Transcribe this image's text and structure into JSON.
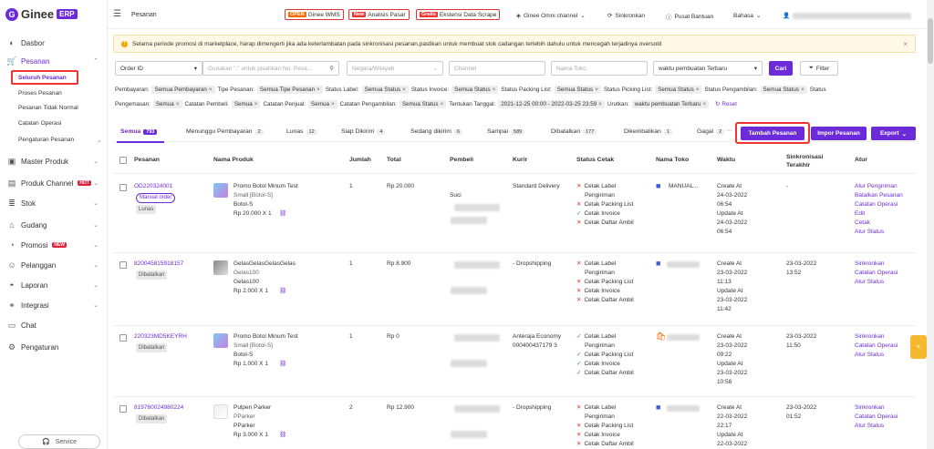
{
  "app": {
    "brand": "Ginee",
    "badge": "ERP",
    "logo_letter": "G"
  },
  "sidebar": {
    "items": [
      {
        "label": "Dasbor",
        "icon": "dashboard-icon"
      },
      {
        "label": "Pesanan",
        "icon": "cart-icon"
      },
      {
        "label": "Master Produk",
        "icon": "cube-icon"
      },
      {
        "label": "Produk Channel",
        "icon": "box-icon",
        "badge": "HOT"
      },
      {
        "label": "Stok",
        "icon": "stack-icon"
      },
      {
        "label": "Gudang",
        "icon": "warehouse-icon"
      },
      {
        "label": "Promosi",
        "icon": "tag-icon",
        "badge": "NEW"
      },
      {
        "label": "Pelanggan",
        "icon": "users-icon"
      },
      {
        "label": "Laporan",
        "icon": "report-icon"
      },
      {
        "label": "Integrasi",
        "icon": "link-icon"
      },
      {
        "label": "Chat",
        "icon": "chat-icon"
      },
      {
        "label": "Pengaturan",
        "icon": "settings-icon"
      }
    ],
    "sub": [
      "Seluruh Pesanan",
      "Proses Pesanan",
      "Pesanan Tidak Normal",
      "Catatan Operasi",
      "Pengaturan Pesanan"
    ],
    "service": "Service"
  },
  "topbar": {
    "page": "Pesanan",
    "wms_tag": "OPEN",
    "wms": "Ginee WMS",
    "ana_tag": "New",
    "ana": "Analisis Pasar",
    "ext_tag": "Gratis",
    "ext": "Ekstensi Data Scrape",
    "omni": "Ginee Omni channel",
    "sync": "Sinkronkan",
    "help": "Pusat Bantuan",
    "lang": "Bahasa"
  },
  "notice": "Selama periode promosi di marketplace, harap dimengerti jika ada keterlambatan pada sinkronisasi pesanan,pastikan untuk membuat stok cadangan terlebih dahulu untuk mencegah terjadinya oversold",
  "filters": {
    "order_select": "Order ID",
    "search_ph": "Gunakan \",\" untuk pisahkan No. Pesa...",
    "country_ph": "Negara/Wilayah",
    "channel_ph": "Channel",
    "store_ph": "Nama Toko",
    "time_select": "waktu pembuatan Terbaru",
    "search_btn": "Cari",
    "filter_btn": "Filter"
  },
  "chips_row1": [
    {
      "k": "Pembayaran:",
      "v": "Semua Pembayaran"
    },
    {
      "k": "Tipe Pesanan:",
      "v": "Semua Tipe Pesanan"
    },
    {
      "k": "Status Label:",
      "v": "Semua Status"
    },
    {
      "k": "Status Invoice:",
      "v": "Semua Status"
    },
    {
      "k": "Status Packing List:",
      "v": "Semua Status"
    },
    {
      "k": "Status Picking List:",
      "v": "Semua Status"
    },
    {
      "k": "Status Pengambilan:",
      "v": "Semua Status"
    }
  ],
  "chips_row1_tail": "Status",
  "chips_row2": [
    {
      "k": "Pengemasan:",
      "v": "Semua"
    },
    {
      "k": "Catatan Pembeli:",
      "v": "Semua"
    },
    {
      "k": "Catatan Penjual:",
      "v": "Semua"
    },
    {
      "k": "Catatan Pengambilan:",
      "v": "Semua Status"
    },
    {
      "k": "Tentukan Tanggal:",
      "v": "2021-12-25 00:00 - 2022-03-25 23:59"
    },
    {
      "k": "Urutkan:",
      "v": "waktu pembuatan Terbaru"
    }
  ],
  "reset": "Reset",
  "tabs": [
    {
      "label": "Semua",
      "count": "793"
    },
    {
      "label": "Menunggu Pembayaran",
      "count": "2"
    },
    {
      "label": "Lunas",
      "count": "12"
    },
    {
      "label": "Siap Dikirim",
      "count": "4"
    },
    {
      "label": "Sedang dikirim",
      "count": "6"
    },
    {
      "label": "Sampai",
      "count": "589"
    },
    {
      "label": "Dibatalkan",
      "count": "177"
    },
    {
      "label": "Dikembalikan",
      "count": "1"
    },
    {
      "label": "Gagal",
      "count": "2"
    }
  ],
  "actions": {
    "add": "Tambah Pesanan",
    "import": "Impor Pesanan",
    "export": "Export"
  },
  "columns": [
    "Pesanan",
    "Nama Produk",
    "Jumlah",
    "Total",
    "Pembeli",
    "Kurir",
    "Status Cetak",
    "Nama Toko",
    "Waktu",
    "Sinkronisasi Terakhir",
    "Atur"
  ],
  "rows": [
    {
      "id": "OD220324001",
      "tags": [
        "Manual order",
        "Lunas"
      ],
      "product": "Promo Botol Minum Test",
      "variant": "Small [Botol-S]",
      "sku": "Botol-S",
      "price": "Rp 20.000 X 1",
      "qty": "1",
      "total": "Rp 20.000",
      "buyer": "Suci",
      "courier": "Standard Delivery",
      "print": [
        [
          "x",
          "Cetak Label"
        ],
        [
          "",
          "Pengiriman"
        ],
        [
          "x",
          "Cetak Packing List"
        ],
        [
          "ok",
          "Cetak Invoice"
        ],
        [
          "x",
          "Cetak Daftar Ambil"
        ]
      ],
      "store": "MANUAL...",
      "time": [
        "Create At",
        "24-03-2022",
        "06:54",
        "Update At",
        "24-03-2022",
        "06:54"
      ],
      "sync": [
        "-"
      ],
      "actions": [
        "Atur Pengiriman",
        "Batalkan Pesanan",
        "Catatan Operasi",
        "Edit",
        "Cetak",
        "Atur Status"
      ]
    },
    {
      "id": "820045815918157",
      "tags": [
        "Dibatalkan"
      ],
      "product": "GelasGelasGelasGelas",
      "variant": "Gelas100",
      "sku": "Gelas100",
      "price": "Rp 2.000 X 1",
      "qty": "1",
      "total": "Rp 8.900",
      "buyer": "",
      "courier": "- Dropshipping",
      "print": [
        [
          "x",
          "Cetak Label"
        ],
        [
          "",
          "Pengiriman"
        ],
        [
          "x",
          "Cetak Packing List"
        ],
        [
          "x",
          "Cetak Invoice"
        ],
        [
          "x",
          "Cetak Daftar Ambil"
        ]
      ],
      "store": "",
      "time": [
        "Create At",
        "23-03-2022",
        "11:13",
        "Update At",
        "23-03-2022",
        "11:42"
      ],
      "sync": [
        "23-03-2022",
        "13:52"
      ],
      "actions": [
        "Sinkronkan",
        "Catatan Operasi",
        "Atur Status"
      ]
    },
    {
      "id": "220323MD5KEYRH",
      "tags": [
        "Dibatalkan"
      ],
      "product": "Promo Botol Minum Test",
      "variant": "Small [Botol-S]",
      "sku": "Botol-S",
      "price": "Rp 1.000 X 1",
      "qty": "1",
      "total": "Rp 0",
      "buyer": "",
      "courier": "Anteraja Economy 000400437179 3",
      "print": [
        [
          "ok",
          "Cetak Label"
        ],
        [
          "",
          "Pengiriman"
        ],
        [
          "ok",
          "Cetak Packing List"
        ],
        [
          "ok",
          "Cetak Invoice"
        ],
        [
          "ok",
          "Cetak Daftar Ambil"
        ]
      ],
      "store": "",
      "time": [
        "Create At",
        "23-03-2022",
        "09:22",
        "Update At",
        "23-03-2022",
        "10:58"
      ],
      "sync": [
        "23-03-2022",
        "11:50"
      ],
      "actions": [
        "Sinkronkan",
        "Catatan Operasi",
        "Atur Status"
      ]
    },
    {
      "id": "819760024980224",
      "tags": [
        "Dibatalkan"
      ],
      "product": "Pulpen Parker",
      "variant": "PParker",
      "sku": "PParker",
      "price": "Rp 3.000 X 1",
      "qty": "2",
      "total": "Rp 12.900",
      "buyer": "",
      "courier": "- Dropshipping",
      "print": [
        [
          "x",
          "Cetak Label"
        ],
        [
          "",
          "Pengiriman"
        ],
        [
          "x",
          "Cetak Packing List"
        ],
        [
          "x",
          "Cetak Invoice"
        ],
        [
          "x",
          "Cetak Daftar Ambil"
        ]
      ],
      "store": "",
      "time": [
        "Create At",
        "22-03-2022",
        "22:17",
        "Update At",
        "22-03-2022"
      ],
      "sync": [
        "23-03-2022",
        "01:52"
      ],
      "actions": [
        "Sinkronkan",
        "Catatan Operasi",
        "Atur Status"
      ]
    }
  ],
  "colors": {
    "accent": "#6c2bd9",
    "highlight": "#e33333"
  }
}
